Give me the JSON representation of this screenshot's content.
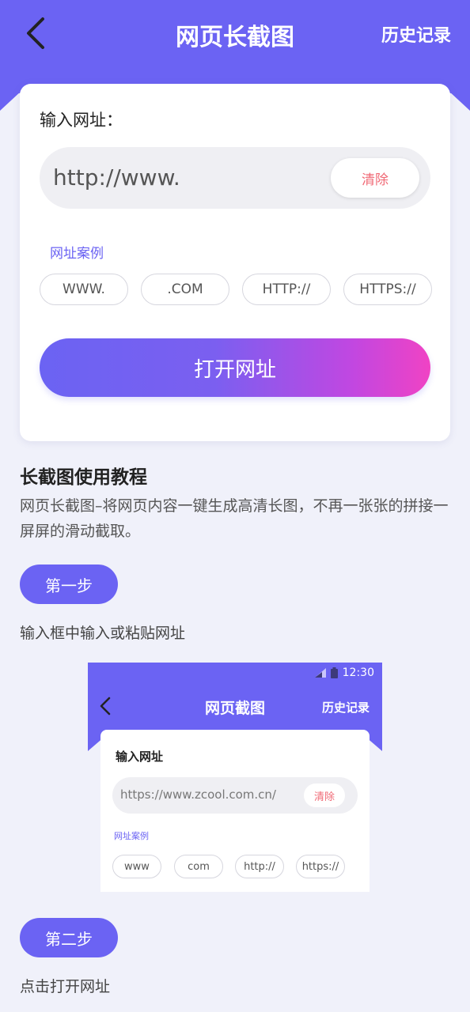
{
  "header": {
    "title": "网页长截图",
    "history_label": "历史记录"
  },
  "input_card": {
    "label": "输入网址：",
    "url_value": "http://www.",
    "clear_label": "清除",
    "examples_label": "网址案例",
    "examples": [
      "WWW.",
      ".COM",
      "HTTP://",
      "HTTPS://"
    ],
    "open_button_label": "打开网址"
  },
  "tutorial": {
    "title": "长截图使用教程",
    "description": "网页长截图–将网页内容一键生成高清长图，不再一张张的拼接一屏屏的滑动截取。",
    "steps": [
      {
        "label": "第一步",
        "text": "输入框中输入或粘贴网址"
      },
      {
        "label": "第二步",
        "text": "点击打开网址"
      }
    ]
  },
  "demo_screenshot": {
    "status_time": "12:30",
    "title": "网页截图",
    "history_label": "历史记录",
    "input_label": "输入网址",
    "url_value": "https://www.zcool.com.cn/",
    "clear_label": "清除",
    "examples_label": "网址案例",
    "examples": [
      "www",
      "com",
      "http://",
      "https://"
    ]
  },
  "colors": {
    "primary": "#6b63f3",
    "gradient_end": "#f043c4",
    "clear_text": "#f06a76",
    "background": "#f0f1fa"
  },
  "icons": {
    "back": "chevron-left-icon",
    "signal": "signal-icon",
    "battery": "battery-icon"
  }
}
